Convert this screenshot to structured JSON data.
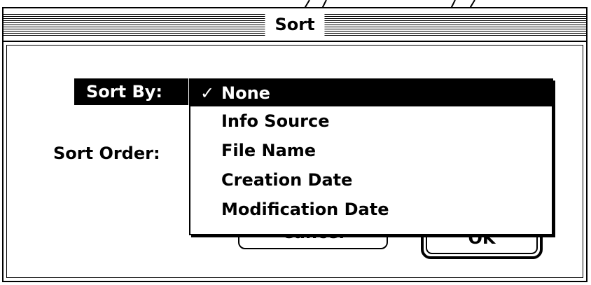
{
  "dialog": {
    "title": "Sort",
    "sort_by_label": "Sort By:",
    "sort_order_label": "Sort Order:",
    "cancel_label": "Cancel",
    "ok_label": "OK"
  },
  "sort_by_menu": {
    "check_glyph": "✓",
    "items": [
      {
        "label": "None",
        "selected": true
      },
      {
        "label": "Info Source",
        "selected": false
      },
      {
        "label": "File Name",
        "selected": false
      },
      {
        "label": "Creation Date",
        "selected": false
      },
      {
        "label": "Modification Date",
        "selected": false
      }
    ]
  }
}
